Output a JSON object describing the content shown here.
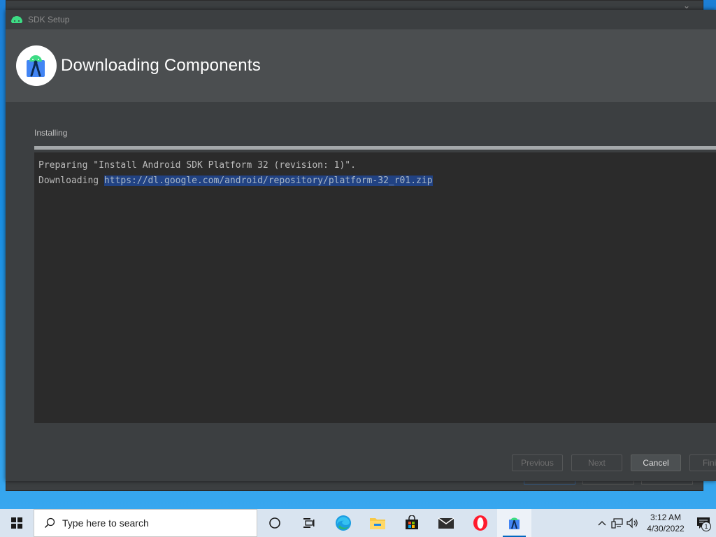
{
  "dialog": {
    "title": "SDK Setup",
    "header_title": "Downloading Components",
    "status_label": "Installing",
    "progress": 1.0,
    "console": {
      "line1": "Preparing \"Install Android SDK Platform 32 (revision: 1)\".",
      "line2_prefix": "Downloading ",
      "line2_url": "https://dl.google.com/android/repository/platform-32_r01.zip"
    },
    "buttons": {
      "previous": "Previous",
      "next": "Next",
      "cancel": "Cancel",
      "finish": "Fini"
    }
  },
  "taskbar": {
    "search_placeholder": "Type here to search",
    "time": "3:12 AM",
    "date": "4/30/2022",
    "notification_count": "1",
    "apps": [
      "cortana-icon",
      "task-view-icon",
      "edge-icon",
      "file-explorer-icon",
      "store-icon",
      "mail-icon",
      "opera-icon",
      "android-studio-icon"
    ]
  },
  "colors": {
    "dialog_bg": "#3c3f41",
    "header_bg": "#4b4e50",
    "console_bg": "#2b2b2b",
    "selection": "#214283",
    "android_green": "#3ddc84"
  }
}
